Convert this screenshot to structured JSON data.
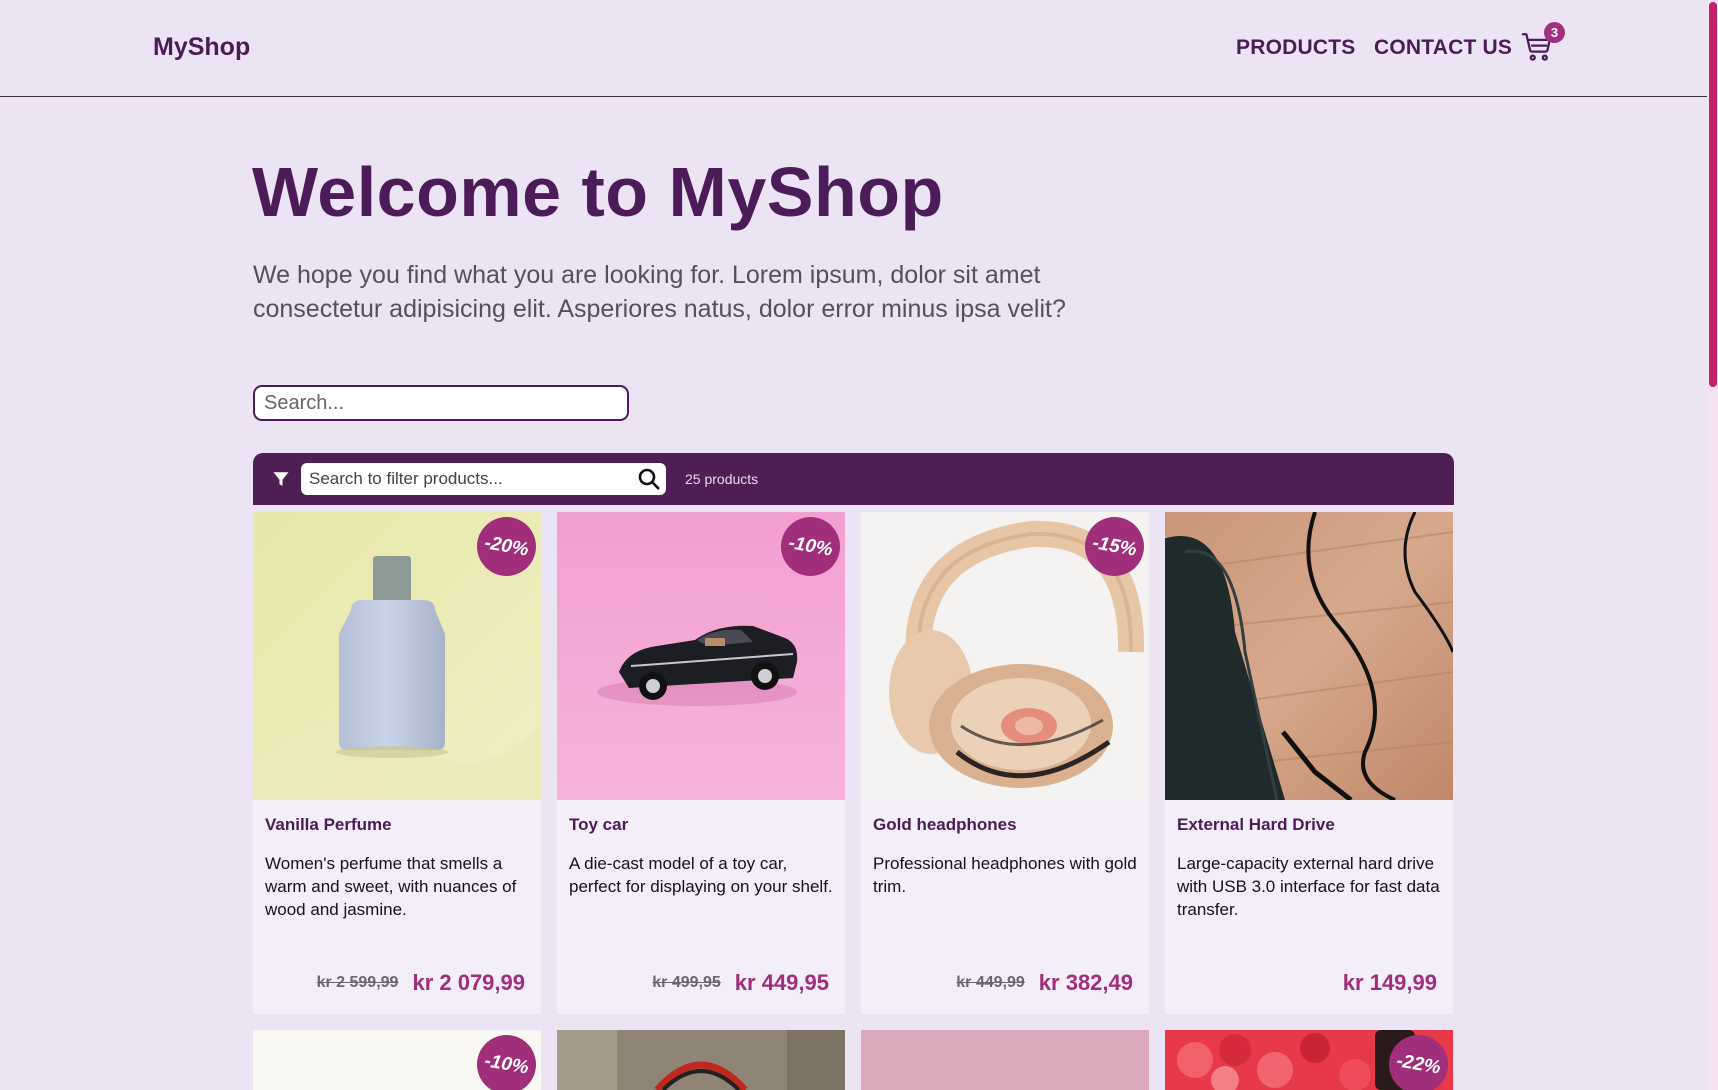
{
  "header": {
    "brand": "MyShop",
    "nav": [
      "PRODUCTS",
      "CONTACT US"
    ],
    "cart_count": "3"
  },
  "hero": {
    "title": "Welcome to MyShop",
    "subtitle": "We hope you find what you are looking for. Lorem ipsum, dolor sit amet consectetur adipisicing elit. Asperiores natus, dolor error minus ipsa velit?",
    "search_placeholder": "Search..."
  },
  "filter": {
    "placeholder": "Search to filter products...",
    "count": "25 products"
  },
  "products": [
    {
      "name": "Vanilla Perfume",
      "desc": "Women's perfume that smells a warm and sweet, with nuances of wood and jasmine.",
      "discount": "-20%",
      "old_price": "kr 2 599,99",
      "price": "kr 2 079,99"
    },
    {
      "name": "Toy car",
      "desc": "A die-cast model of a toy car, perfect for displaying on your shelf.",
      "discount": "-10%",
      "old_price": "kr 499,95",
      "price": "kr 449,95"
    },
    {
      "name": "Gold headphones",
      "desc": "Professional headphones with gold trim.",
      "discount": "-15%",
      "old_price": "kr 449,99",
      "price": "kr 382,49"
    },
    {
      "name": "External Hard Drive",
      "desc": "Large-capacity external hard drive with USB 3.0 interface for fast data transfer.",
      "discount": "",
      "old_price": "",
      "price": "kr 149,99"
    }
  ],
  "next_row_badges": [
    "-10%",
    "",
    "",
    "-22%"
  ],
  "colors": {
    "background": "#ece3f5",
    "primary": "#4b1c57",
    "accent": "#a02e7a",
    "filter_bar": "#4e1e55"
  }
}
